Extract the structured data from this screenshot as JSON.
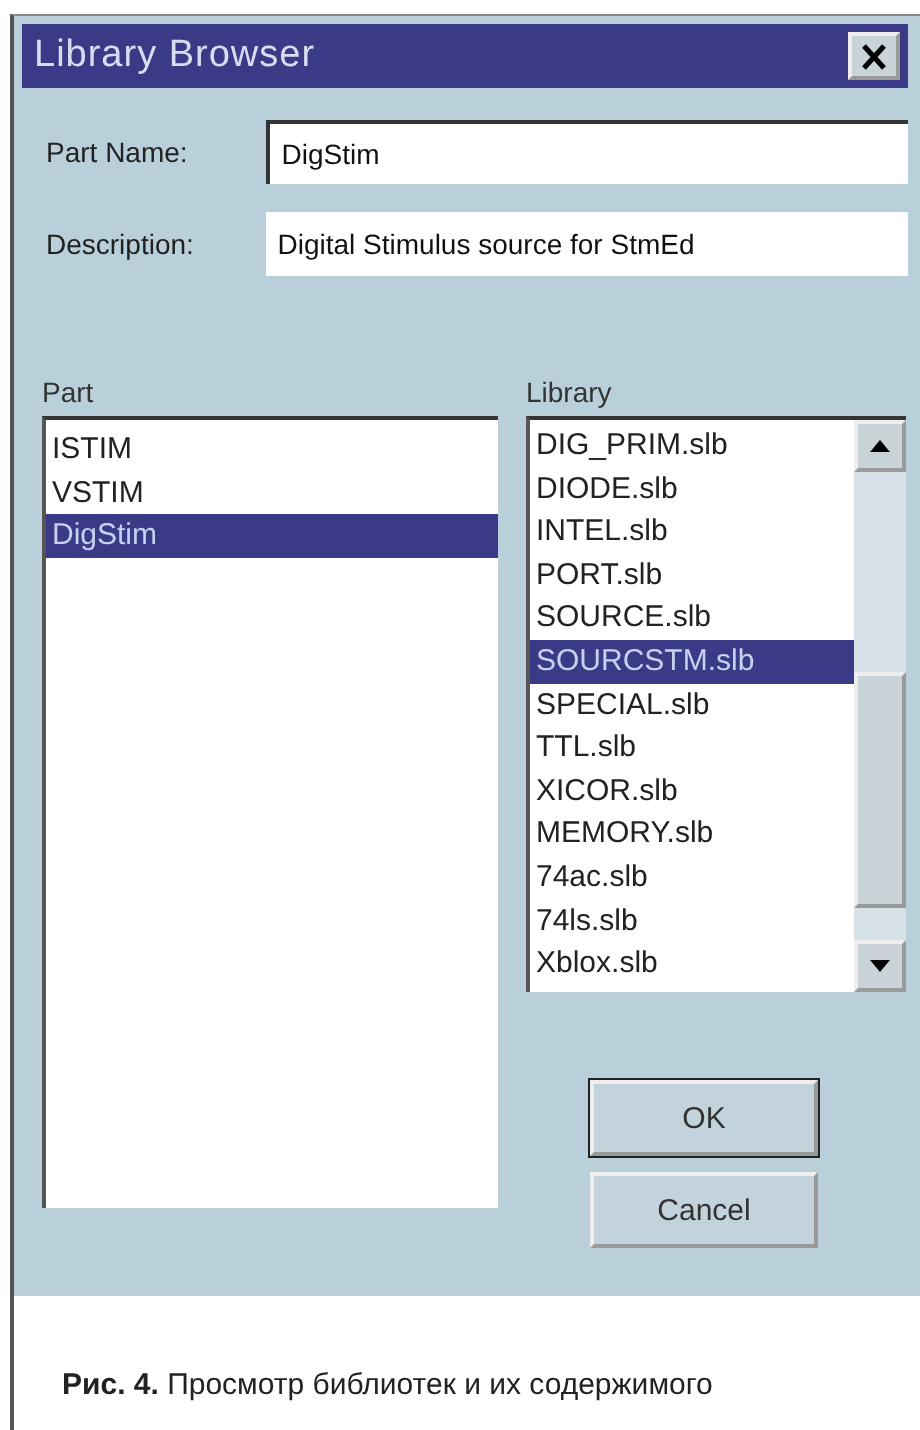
{
  "window": {
    "title": "Library Browser"
  },
  "fields": [
    {
      "label": "Part Name:",
      "value": "DigStim"
    },
    {
      "label": "Description:",
      "value": "Digital Stimulus source for StmEd"
    }
  ],
  "part_list": {
    "label": "Part",
    "items": [
      {
        "label": "ISTIM",
        "selected": false
      },
      {
        "label": "VSTIM",
        "selected": false
      },
      {
        "label": "DigStim",
        "selected": true
      }
    ]
  },
  "library_list": {
    "label": "Library",
    "items": [
      {
        "label": "DIG_PRIM.slb",
        "selected": false
      },
      {
        "label": "DIODE.slb",
        "selected": false
      },
      {
        "label": "INTEL.slb",
        "selected": false
      },
      {
        "label": "PORT.slb",
        "selected": false
      },
      {
        "label": "SOURCE.slb",
        "selected": false
      },
      {
        "label": "SOURCSTM.slb",
        "selected": true
      },
      {
        "label": "SPECIAL.slb",
        "selected": false
      },
      {
        "label": "TTL.slb",
        "selected": false
      },
      {
        "label": "XICOR.slb",
        "selected": false
      },
      {
        "label": "MEMORY.slb",
        "selected": false
      },
      {
        "label": "74ac.slb",
        "selected": false
      },
      {
        "label": "74ls.slb",
        "selected": false
      },
      {
        "label": "Xblox.slb",
        "selected": false
      }
    ]
  },
  "buttons": [
    "OK",
    "Cancel"
  ],
  "caption": "**Рис. 4.** Просмотр библиотек и их содержимого"
}
